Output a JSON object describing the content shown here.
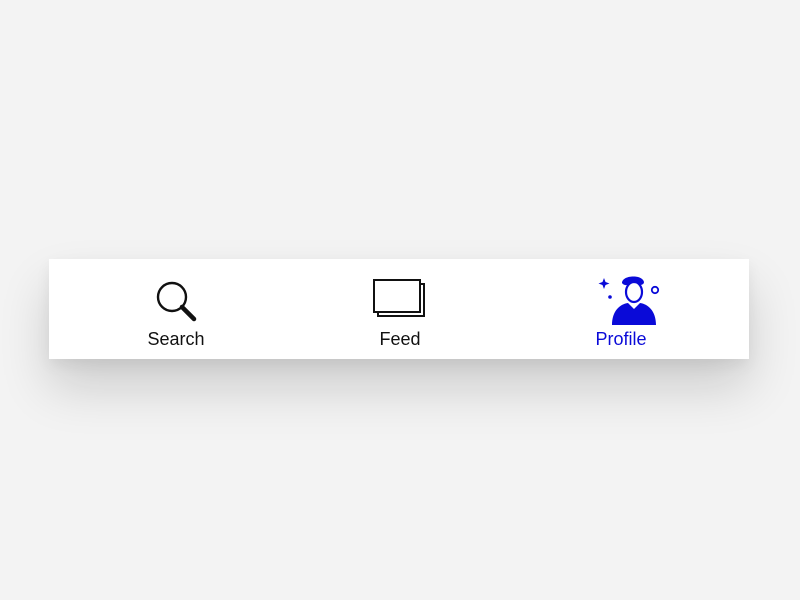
{
  "tabbar": {
    "accent_color": "#0a0ad8",
    "inactive_color": "#111111",
    "background_color": "#ffffff",
    "active_tab": "Profile",
    "tabs": [
      {
        "label": "Search",
        "icon": "magnifier-icon",
        "active": false
      },
      {
        "label": "Feed",
        "icon": "stacked-cards-icon",
        "active": false
      },
      {
        "label": "Profile",
        "icon": "user-sparkle-icon",
        "active": true
      }
    ]
  }
}
